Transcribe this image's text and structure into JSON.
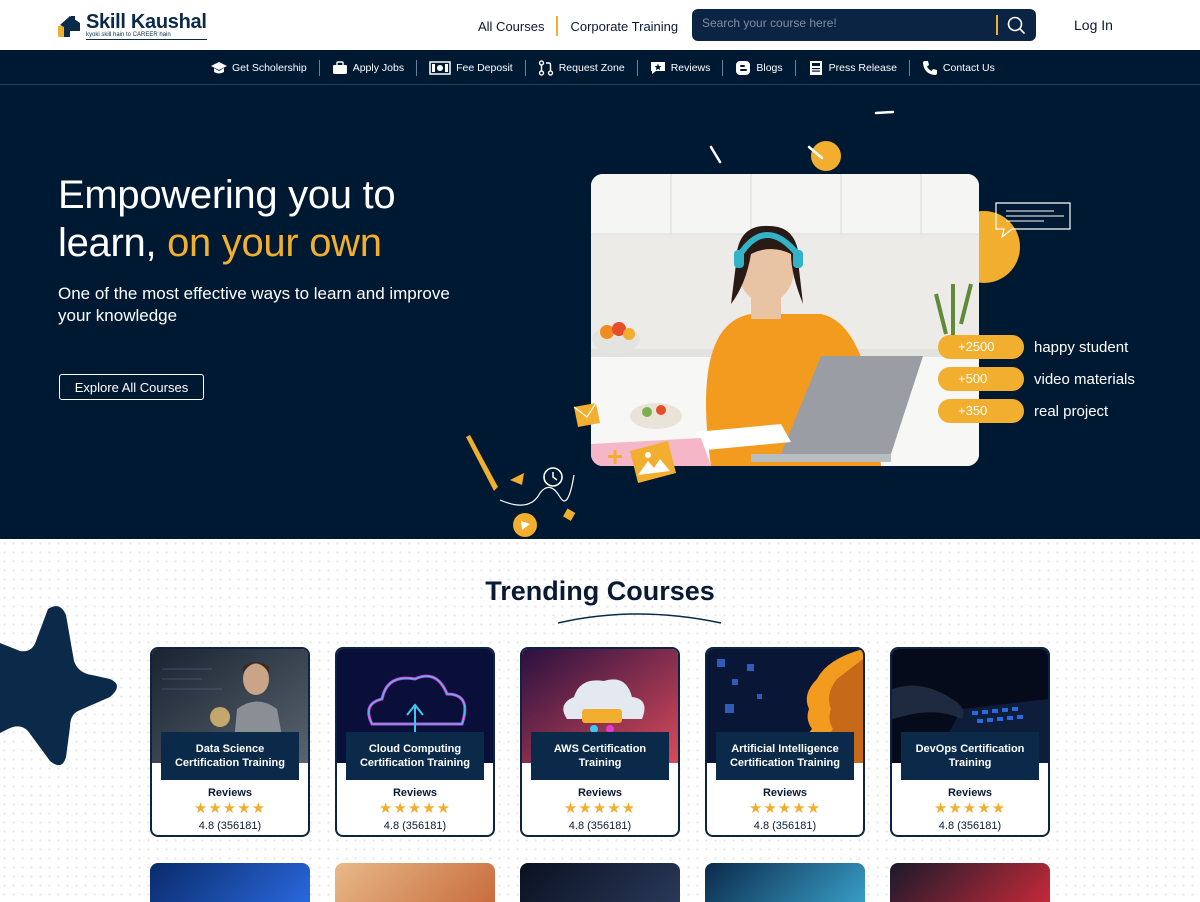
{
  "brand": {
    "name": "Skill Kaushal",
    "tagline": "kyoki skill hain to CAREER hain"
  },
  "header": {
    "links": [
      "All Courses",
      "Corporate Training"
    ],
    "search_placeholder": "Search your course here!",
    "login": "Log In"
  },
  "nav": {
    "items": [
      {
        "label": "Get Scholership",
        "icon": "graduation-cap-icon"
      },
      {
        "label": "Apply Jobs",
        "icon": "briefcase-icon"
      },
      {
        "label": "Fee Deposit",
        "icon": "money-icon"
      },
      {
        "label": "Request Zone",
        "icon": "git-pull-request-icon"
      },
      {
        "label": "Reviews",
        "icon": "review-star-icon"
      },
      {
        "label": "Blogs",
        "icon": "blogger-icon"
      },
      {
        "label": "Press Release",
        "icon": "newspaper-icon"
      },
      {
        "label": "Contact Us",
        "icon": "phone-icon"
      }
    ]
  },
  "hero": {
    "title_line1": "Empowering you to",
    "title_line2_plain": "learn, ",
    "title_line2_accent": "on your own",
    "subtitle": "One of the most effective ways to learn and improve your knowledge",
    "cta": "Explore All Courses",
    "stats": [
      {
        "value": "+2500",
        "label": "happy student"
      },
      {
        "value": "+500",
        "label": "video materials"
      },
      {
        "value": "+350",
        "label": "real project"
      }
    ]
  },
  "trending": {
    "title": "Trending Courses",
    "cards": [
      {
        "title": "Data Science Certification Training",
        "reviews_label": "Reviews",
        "stars": 5,
        "rating": "4.8 (356181)"
      },
      {
        "title": "Cloud Computing Certification Training",
        "reviews_label": "Reviews",
        "stars": 5,
        "rating": "4.8 (356181)"
      },
      {
        "title": "AWS Certification Training",
        "reviews_label": "Reviews",
        "stars": 5,
        "rating": "4.8 (356181)"
      },
      {
        "title": "Artificial Intelligence Certification Training",
        "reviews_label": "Reviews",
        "stars": 5,
        "rating": "4.8 (356181)"
      },
      {
        "title": "DevOps Certification Training",
        "reviews_label": "Reviews",
        "stars": 5,
        "rating": "4.8 (356181)"
      }
    ]
  },
  "colors": {
    "navy": "#001933",
    "accent": "#f2ae2e",
    "card_navy": "#0b2a4a"
  }
}
